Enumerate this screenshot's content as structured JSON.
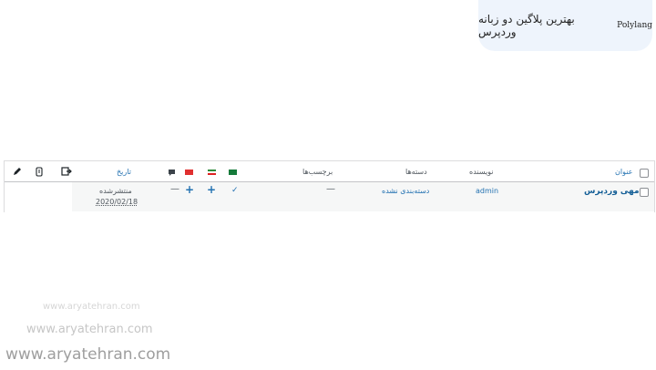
{
  "header": {
    "title_fa": "بهترین پلاگین دو زبانه وردپرس",
    "title_brand": "Polylang"
  },
  "table": {
    "columns": {
      "title": "عنوان",
      "author": "نویسنده",
      "categories": "دسته‌ها",
      "tags": "برچسب‌ها",
      "date": "تاریخ"
    },
    "row": {
      "title": "مهی وردپرس",
      "author": "admin",
      "category": "دسته‌بندی نشده",
      "tags": "—",
      "lang_status": [
        "✓",
        "+",
        "+"
      ],
      "comments": "—",
      "status": "منتشرشده",
      "date": "2020/02/18"
    }
  },
  "icons": {
    "col_comments": "comment-bubble-icon",
    "col_flags": [
      "iran-flag-icon",
      "saudi-flag-icon",
      "turkey-flag-icon"
    ],
    "col_extra": [
      "sync-icon",
      "mobile-icon",
      "pencil-icon"
    ]
  },
  "watermarks": [
    "www.aryatehran.com",
    "www.aryatehran.com",
    "www.aryatehran.com"
  ]
}
